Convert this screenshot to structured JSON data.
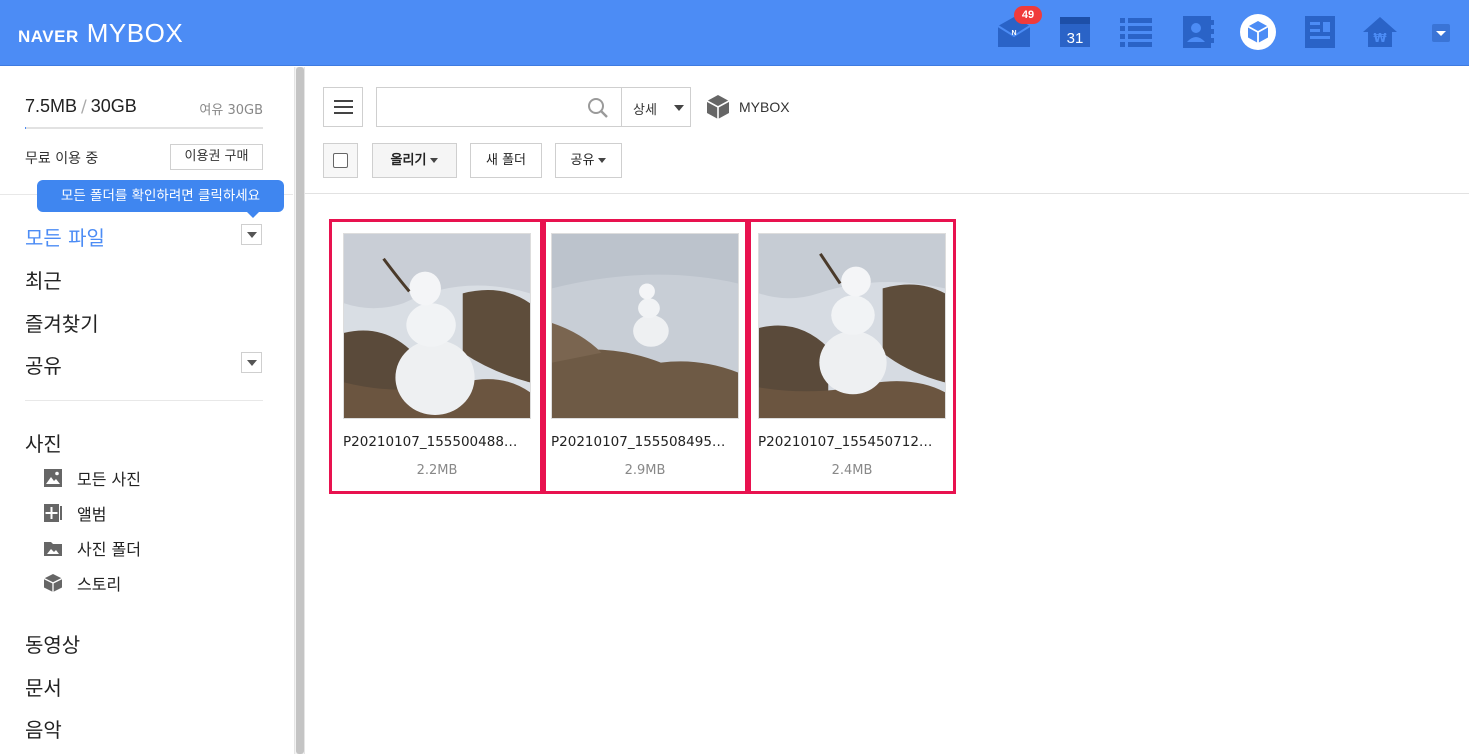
{
  "header": {
    "brand_naver": "NAVER",
    "brand_mybox": "MYBOX",
    "mail_badge": "49",
    "calendar_date": "31",
    "currency_symbol": "₩",
    "icons": [
      "mail-icon",
      "calendar-icon",
      "list-icon",
      "contacts-icon",
      "mybox-icon",
      "memo-icon",
      "home-store-icon",
      "menu-dropdown-icon"
    ],
    "colors": {
      "bar": "#4c8cf5",
      "badge": "#f03b3b"
    }
  },
  "sidebar": {
    "storage_used": "7.5MB",
    "storage_total": "30GB",
    "storage_free": "여유 30GB",
    "storage_used_fraction": 0.0002,
    "plan_label": "무료 이용 중",
    "buy_button": "이용권 구매",
    "tooltip": "모든 폴더를 확인하려면 클릭하세요",
    "nav": {
      "all_files": "모든 파일",
      "recent": "최근",
      "favorites": "즐겨찾기",
      "shared": "공유",
      "photos": "사진",
      "videos": "동영상",
      "documents": "문서",
      "music": "음악"
    },
    "photo_sub": {
      "all_photos": "모든 사진",
      "album": "앨범",
      "photo_folder": "사진 폴더",
      "story": "스토리"
    }
  },
  "toolbar": {
    "search_placeholder": "",
    "detail_label": "상세",
    "breadcrumb": "MYBOX",
    "upload_label": "올리기",
    "new_folder_label": "새 폴더",
    "share_label": "공유"
  },
  "files": [
    {
      "name": "P20210107_155500488…",
      "size": "2.2MB"
    },
    {
      "name": "P20210107_155508495…",
      "size": "2.9MB"
    },
    {
      "name": "P20210107_155450712…",
      "size": "2.4MB"
    }
  ],
  "selection_color": "#e8124f"
}
